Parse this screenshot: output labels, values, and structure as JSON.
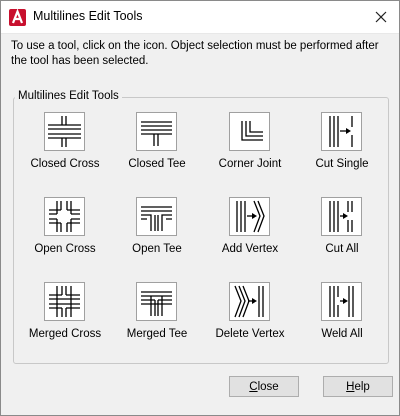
{
  "window": {
    "title": "Multilines Edit Tools",
    "close_glyph": "✕"
  },
  "instructions": "To use a tool, click on the icon.  Object selection must be performed after the tool has been selected.",
  "group": {
    "label": "Multilines Edit Tools"
  },
  "tools": [
    {
      "label": "Closed Cross",
      "icon": "closed-cross-icon"
    },
    {
      "label": "Closed Tee",
      "icon": "closed-tee-icon"
    },
    {
      "label": "Corner Joint",
      "icon": "corner-joint-icon"
    },
    {
      "label": "Cut Single",
      "icon": "cut-single-icon"
    },
    {
      "label": "Open Cross",
      "icon": "open-cross-icon"
    },
    {
      "label": "Open Tee",
      "icon": "open-tee-icon"
    },
    {
      "label": "Add Vertex",
      "icon": "add-vertex-icon"
    },
    {
      "label": "Cut All",
      "icon": "cut-all-icon"
    },
    {
      "label": "Merged Cross",
      "icon": "merged-cross-icon"
    },
    {
      "label": "Merged Tee",
      "icon": "merged-tee-icon"
    },
    {
      "label": "Delete Vertex",
      "icon": "delete-vertex-icon"
    },
    {
      "label": "Weld All",
      "icon": "weld-all-icon"
    }
  ],
  "buttons": {
    "close": "Close",
    "help": "Help"
  },
  "colors": {
    "dialog_bg": "#f0f0f0",
    "title_bg": "#ffffff",
    "app_icon_red": "#c8102e"
  }
}
